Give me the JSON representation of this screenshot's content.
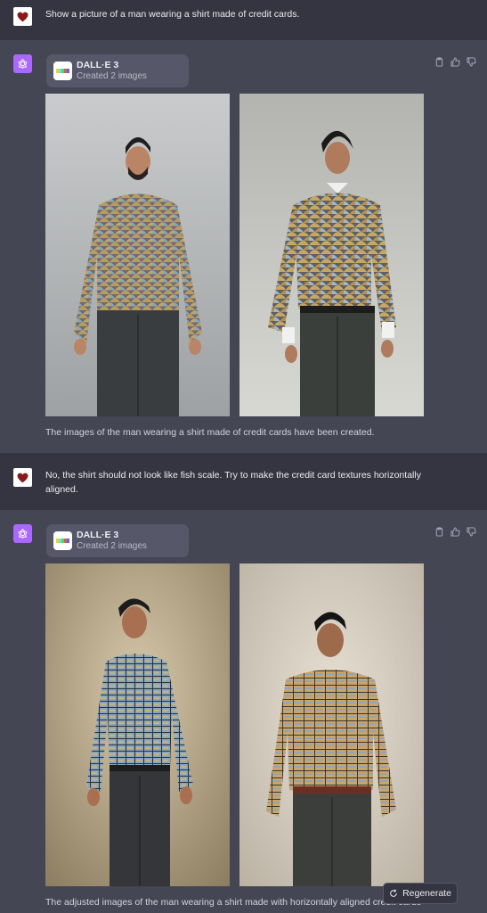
{
  "messages": [
    {
      "role": "user",
      "text": "Show a picture of a man wearing a shirt made of credit cards."
    },
    {
      "role": "assistant",
      "tool": {
        "name": "DALL·E 3",
        "status": "Created 2 images"
      },
      "caption": "The images of the man wearing a shirt made of credit cards have been created."
    },
    {
      "role": "user",
      "text": "No, the shirt should not look like fish scale. Try to make the credit card textures horizontally aligned."
    },
    {
      "role": "assistant",
      "tool": {
        "name": "DALL·E 3",
        "status": "Created 2 images"
      },
      "caption": "The adjusted images of the man wearing a shirt made with horizontally aligned credit cards"
    }
  ],
  "regenerate_label": "Regenerate",
  "icons": {
    "user_avatar": "heart-icon",
    "assistant_avatar": "openai-logo-icon",
    "copy": "clipboard-icon",
    "like": "thumbs-up-icon",
    "dislike": "thumbs-down-icon",
    "regenerate": "refresh-icon"
  },
  "colors": {
    "user_bg": "#343541",
    "assistant_bg": "#444654",
    "avatar_purple": "#ab68ff",
    "chip_bg": "#565869",
    "text": "#ececf1"
  }
}
